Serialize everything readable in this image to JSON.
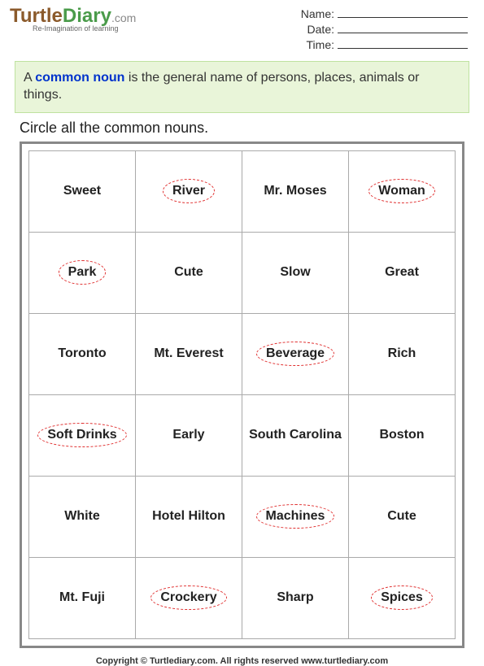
{
  "logo": {
    "part1": "Turtle",
    "part2": "Diary",
    "dotcom": ".com",
    "tagline": "Re-Imagination of learning"
  },
  "info": {
    "name_label": "Name:",
    "date_label": "Date:",
    "time_label": "Time:"
  },
  "definition": {
    "prefix": "A ",
    "keyword": "common noun",
    "rest": " is the general name of persons, places, animals or things."
  },
  "instruction": "Circle all the common nouns.",
  "grid": [
    [
      {
        "w": "Sweet",
        "c": false
      },
      {
        "w": "River",
        "c": true
      },
      {
        "w": "Mr. Moses",
        "c": false
      },
      {
        "w": "Woman",
        "c": true
      }
    ],
    [
      {
        "w": "Park",
        "c": true
      },
      {
        "w": "Cute",
        "c": false
      },
      {
        "w": "Slow",
        "c": false
      },
      {
        "w": "Great",
        "c": false
      }
    ],
    [
      {
        "w": "Toronto",
        "c": false
      },
      {
        "w": "Mt. Everest",
        "c": false
      },
      {
        "w": "Beverage",
        "c": true
      },
      {
        "w": "Rich",
        "c": false
      }
    ],
    [
      {
        "w": "Soft Drinks",
        "c": true
      },
      {
        "w": "Early",
        "c": false
      },
      {
        "w": "South Carolina",
        "c": false
      },
      {
        "w": "Boston",
        "c": false
      }
    ],
    [
      {
        "w": "White",
        "c": false
      },
      {
        "w": "Hotel Hilton",
        "c": false
      },
      {
        "w": "Machines",
        "c": true
      },
      {
        "w": "Cute",
        "c": false
      }
    ],
    [
      {
        "w": "Mt. Fuji",
        "c": false
      },
      {
        "w": "Crockery",
        "c": true
      },
      {
        "w": "Sharp",
        "c": false
      },
      {
        "w": "Spices",
        "c": true
      }
    ]
  ],
  "footer": "Copyright © Turtlediary.com. All rights reserved  www.turtlediary.com"
}
